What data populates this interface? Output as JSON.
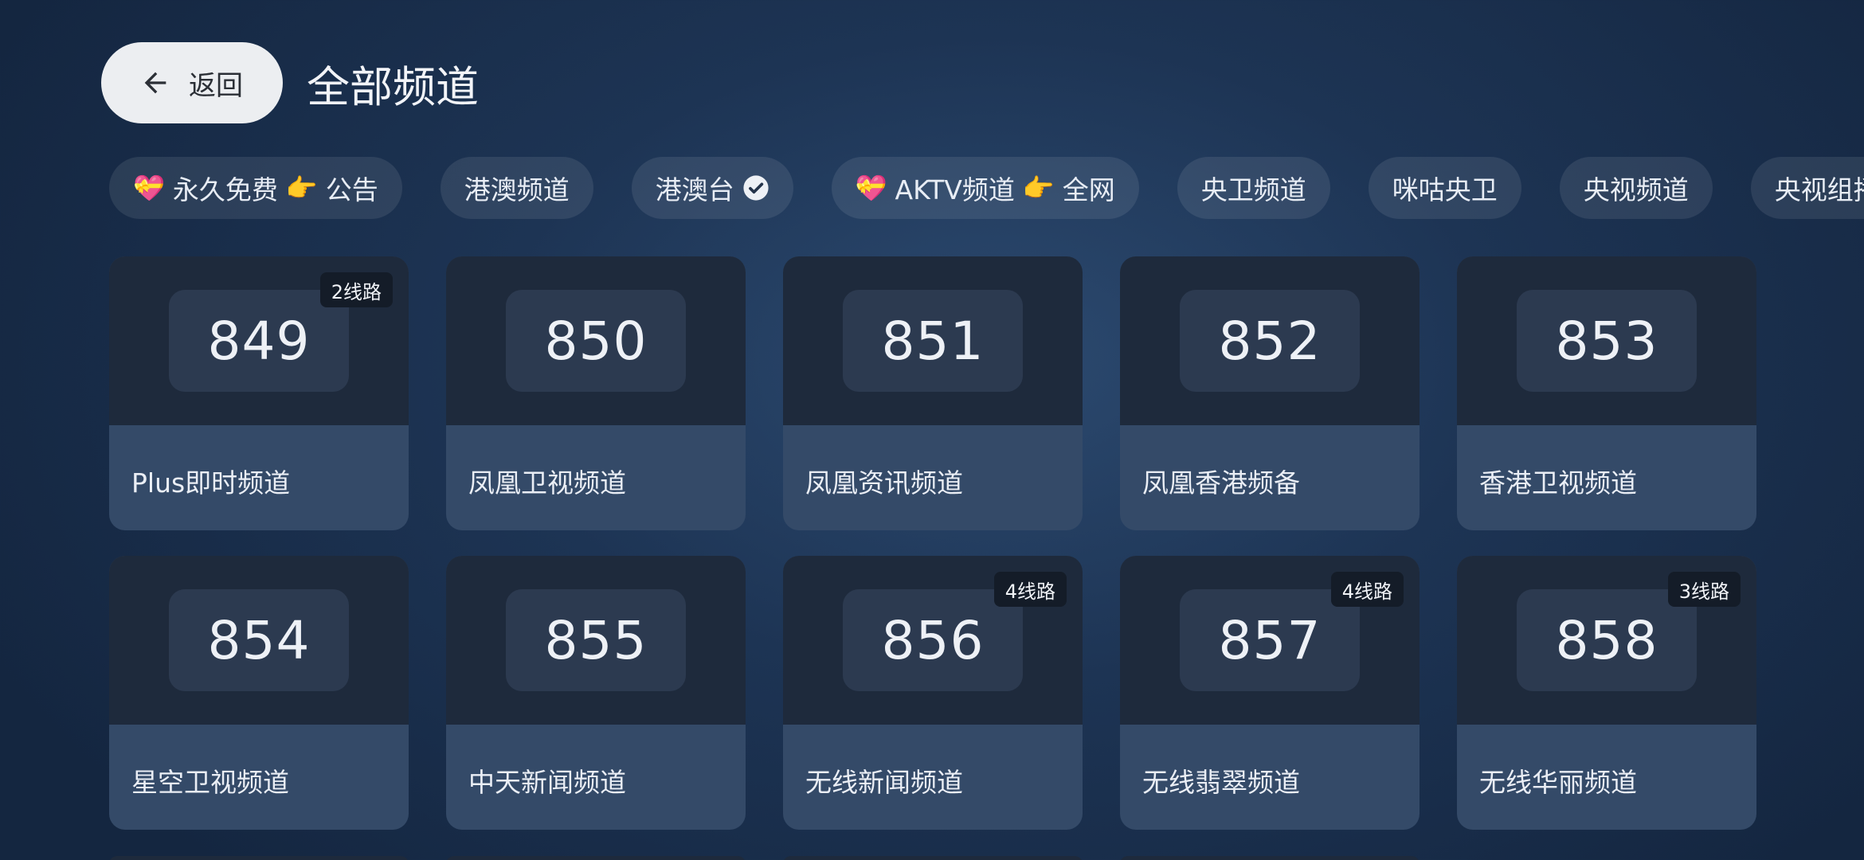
{
  "header": {
    "back_label": "返回",
    "title": "全部频道"
  },
  "tabs": [
    {
      "prefix_icon": "heart",
      "label": "永久免费",
      "mid_icon": "point",
      "suffix": "公告",
      "checked": false
    },
    {
      "label": "港澳频道",
      "checked": false
    },
    {
      "label": "港澳台",
      "checked": true
    },
    {
      "prefix_icon": "heart",
      "label": "AKTV频道",
      "mid_icon": "point",
      "suffix": "全网",
      "checked": false
    },
    {
      "label": "央卫频道",
      "checked": false
    },
    {
      "label": "咪咕央卫",
      "checked": false
    },
    {
      "label": "央视频道",
      "checked": false
    },
    {
      "label": "央视组播",
      "checked": false
    }
  ],
  "channels": [
    {
      "number": "849",
      "name": "Plus即时频道",
      "badge": "2线路"
    },
    {
      "number": "850",
      "name": "凤凰卫视频道",
      "badge": ""
    },
    {
      "number": "851",
      "name": "凤凰资讯频道",
      "badge": ""
    },
    {
      "number": "852",
      "name": "凤凰香港频备",
      "badge": ""
    },
    {
      "number": "853",
      "name": "香港卫视频道",
      "badge": ""
    },
    {
      "number": "854",
      "name": "星空卫视频道",
      "badge": ""
    },
    {
      "number": "855",
      "name": "中天新闻频道",
      "badge": ""
    },
    {
      "number": "856",
      "name": "无线新闻频道",
      "badge": "4线路"
    },
    {
      "number": "857",
      "name": "无线翡翠频道",
      "badge": "4线路"
    },
    {
      "number": "858",
      "name": "无线华丽频道",
      "badge": "3线路"
    }
  ],
  "colors": {
    "background": "#1d3454",
    "card_top": "#1e2a3c",
    "card_bottom": "#344a68",
    "back_button": "#eceef1"
  }
}
